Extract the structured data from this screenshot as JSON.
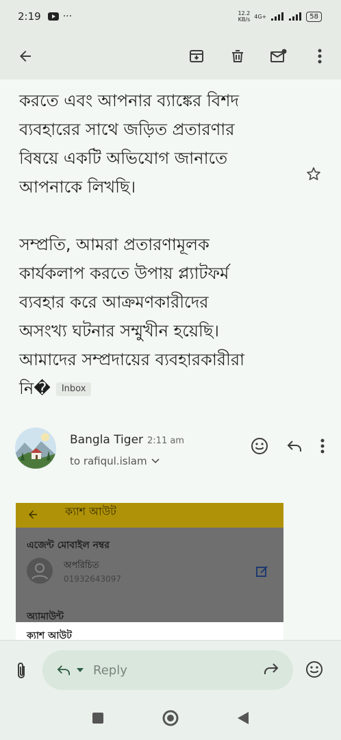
{
  "status": {
    "time": "2:19",
    "net_speed_value": "12.2",
    "net_speed_unit": "KB/s",
    "network": "4G+",
    "battery": "58"
  },
  "email": {
    "body_lines": [
      "করতে এবং আপনার ব্যাঙ্কের বিশদ",
      "ব্যবহারের সাথে জড়িত প্রতারণার",
      "বিষয়ে একটি অভিযোগ জানাতে",
      "আপনাকে লিখছি।",
      "",
      "সম্প্রতি, আমরা প্রতারণামূলক",
      "কার্যকলাপ করতে উপায় প্ল্যাটফর্ম",
      "ব্যবহার করে আক্রমণকারীদের",
      "অসংখ্য ঘটনার সম্মুখীন হয়েছি।",
      "আমাদের সম্প্রদায়ের ব্যবহারকারীরা"
    ],
    "last_fragment": "নি�",
    "label": "Inbox"
  },
  "sender": {
    "name": "Bangla Tiger",
    "time": "2:11 am",
    "to": "to rafiqul.islam"
  },
  "attachment": {
    "header_title": "ক্যাশ আউট",
    "section1": "এজেন্ট মোবাইল নম্বর",
    "contact_name": "অপরিচিত",
    "contact_number": "01932643097",
    "section2": "অ্যামাউন্ট",
    "section3": "ক্যাশ আউট"
  },
  "reply": {
    "placeholder": "Reply"
  }
}
